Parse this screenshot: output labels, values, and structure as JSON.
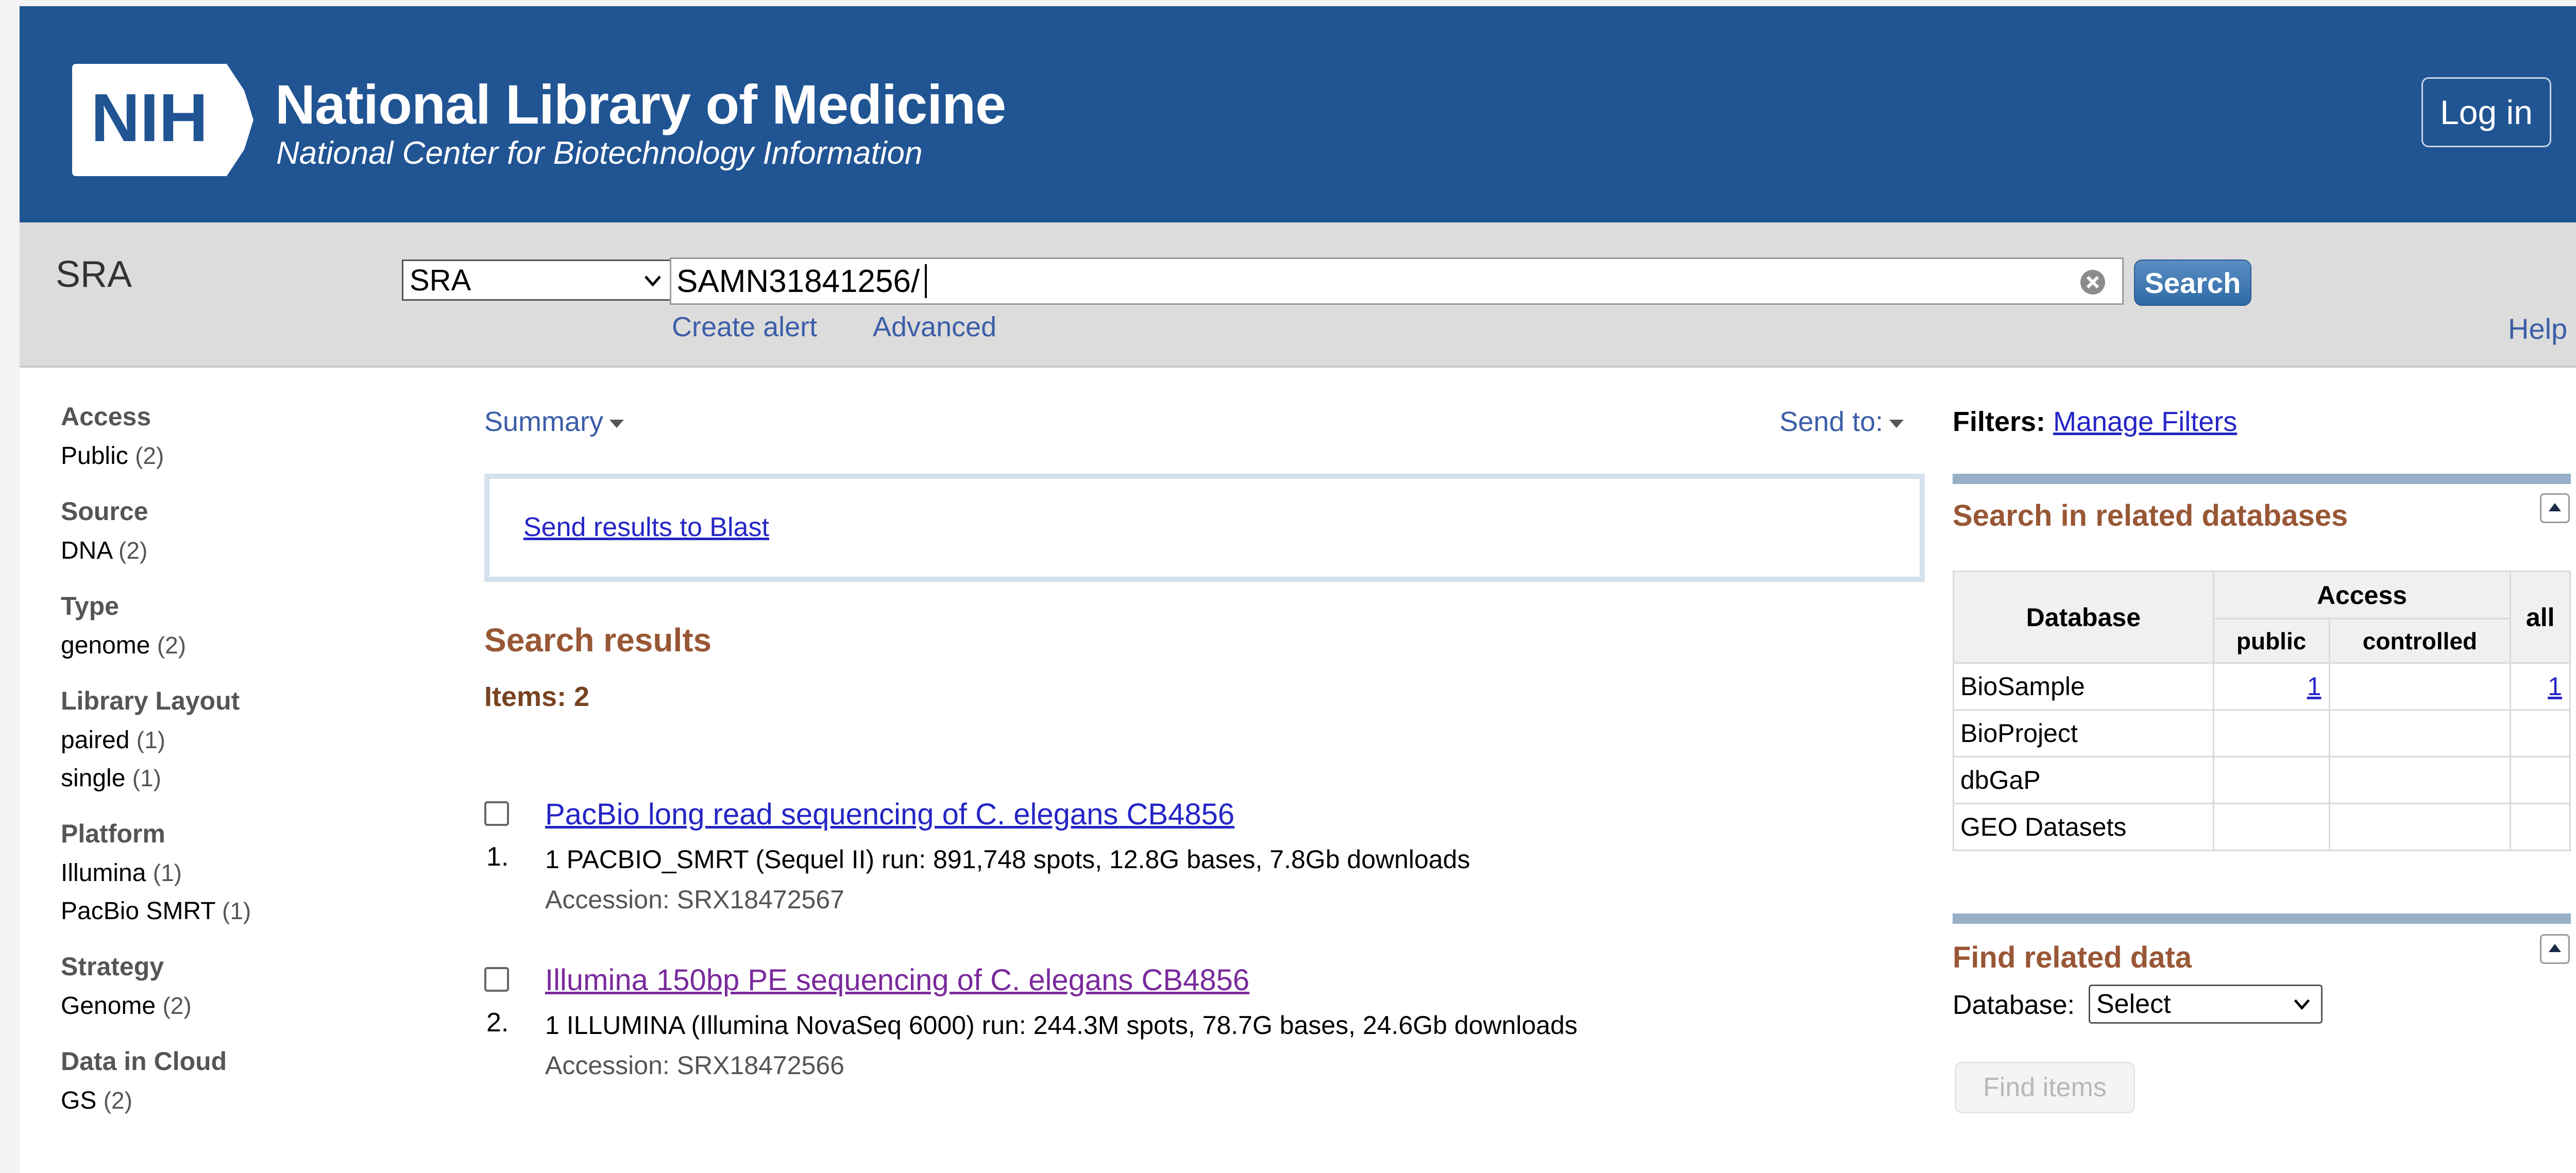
{
  "header": {
    "logo_text": "NIH",
    "title": "National Library of Medicine",
    "subtitle": "National Center for Biotechnology Information",
    "login_label": "Log in"
  },
  "searchbar": {
    "db_label": "SRA",
    "db_selected": "SRA",
    "query": "SAMN31841256/",
    "search_label": "Search",
    "create_alert": "Create alert",
    "advanced": "Advanced",
    "help": "Help"
  },
  "facets": [
    {
      "title": "Access",
      "items": [
        {
          "label": "Public",
          "count": "(2)"
        }
      ]
    },
    {
      "title": "Source",
      "items": [
        {
          "label": "DNA",
          "count": "(2)"
        }
      ]
    },
    {
      "title": "Type",
      "items": [
        {
          "label": "genome",
          "count": "(2)"
        }
      ]
    },
    {
      "title": "Library Layout",
      "items": [
        {
          "label": "paired",
          "count": "(1)"
        },
        {
          "label": "single",
          "count": "(1)"
        }
      ]
    },
    {
      "title": "Platform",
      "items": [
        {
          "label": "Illumina",
          "count": "(1)"
        },
        {
          "label": "PacBio SMRT",
          "count": "(1)"
        }
      ]
    },
    {
      "title": "Strategy",
      "items": [
        {
          "label": "Genome",
          "count": "(2)"
        }
      ]
    },
    {
      "title": "Data in Cloud",
      "items": [
        {
          "label": "GS",
          "count": "(2)"
        }
      ]
    }
  ],
  "main": {
    "summary_label": "Summary",
    "send_to_label": "Send to:",
    "blast_link": "Send results to Blast",
    "results_heading": "Search results",
    "items_count": "Items: 2",
    "results": [
      {
        "number": "1.",
        "title": "PacBio long read sequencing of C. elegans CB4856",
        "description": "1 PACBIO_SMRT (Sequel II) run: 891,748 spots, 12.8G bases, 7.8Gb downloads",
        "accession": "Accession: SRX18472567",
        "title_color": "#2525c6"
      },
      {
        "number": "2.",
        "title": "Illumina 150bp PE sequencing of C. elegans CB4856",
        "description": "1 ILLUMINA (Illumina NovaSeq 6000) run: 244.3M spots, 78.7G bases, 24.6Gb downloads",
        "accession": "Accession: SRX18472566",
        "title_color": "#7a2a9c"
      }
    ]
  },
  "right": {
    "filters_label": "Filters:",
    "manage_filters": "Manage Filters",
    "related_title": "Search in related databases",
    "table_headers": {
      "database": "Database",
      "access": "Access",
      "public": "public",
      "controlled": "controlled",
      "all": "all"
    },
    "table_rows": [
      {
        "db": "BioSample",
        "public": "1",
        "controlled": "",
        "all": "1"
      },
      {
        "db": "BioProject",
        "public": "",
        "controlled": "",
        "all": ""
      },
      {
        "db": "dbGaP",
        "public": "",
        "controlled": "",
        "all": ""
      },
      {
        "db": "GEO Datasets",
        "public": "",
        "controlled": "",
        "all": ""
      }
    ],
    "find_related_title": "Find related data",
    "database_label": "Database:",
    "database_selected": "Select",
    "find_items_label": "Find items"
  },
  "colors": {
    "header_bg": "#205493",
    "heading_brown": "#985735",
    "link_blue": "#2525c6",
    "visited_purple": "#7a2a9c"
  }
}
